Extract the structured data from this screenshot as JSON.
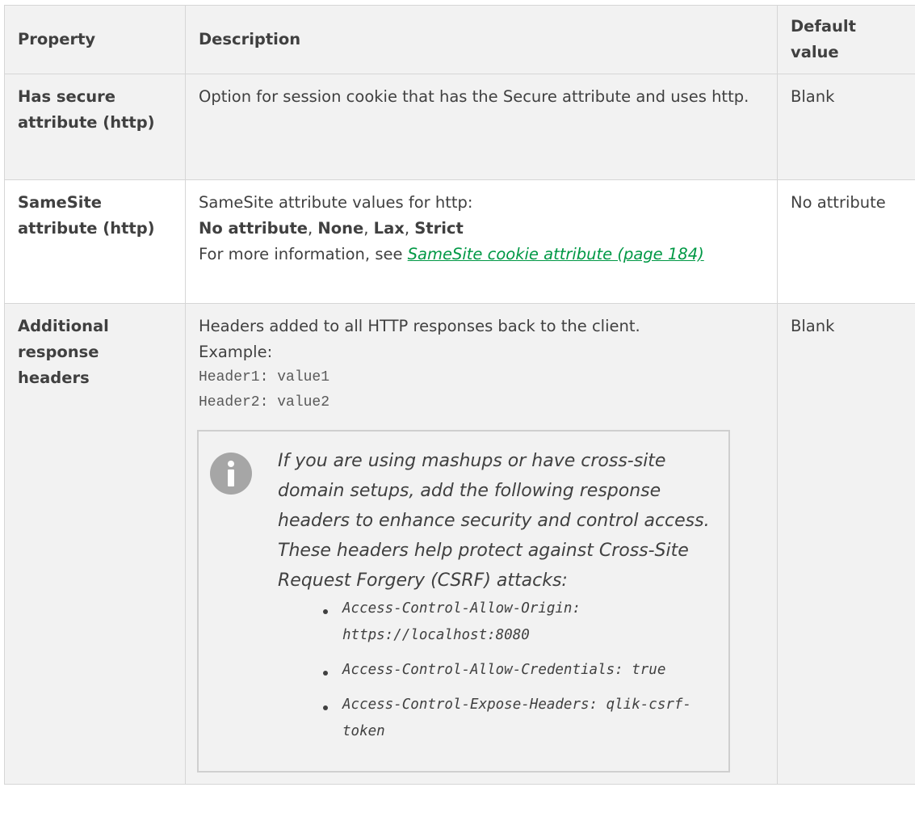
{
  "header": {
    "property": "Property",
    "description": "Description",
    "default_value": "Default value"
  },
  "rows": [
    {
      "property": "Has secure attribute (http)",
      "description": "Option for session cookie that has the Secure attribute and uses http.",
      "default": "Blank"
    },
    {
      "property": "SameSite attribute (http)",
      "description_line1": "SameSite attribute values for http:",
      "options": [
        "No attribute",
        "None",
        "Lax",
        "Strict"
      ],
      "option_separator": ", ",
      "more_info_prefix": "For more information, see ",
      "more_info_link": "SameSite cookie attribute (page 184)",
      "default": "No attribute"
    },
    {
      "property": "Additional response headers",
      "description_line1": "Headers added to all HTTP responses back to the client.",
      "example_label": "Example:",
      "example_code": [
        "Header1: value1",
        "Header2: value2"
      ],
      "note": {
        "icon": "info-icon",
        "text": "If you are using mashups or have cross-site domain setups, add the following response headers to enhance security and control access. These headers help protect against Cross-Site Request Forgery (CSRF) attacks:",
        "items": [
          "Access-Control-Allow-Origin: https://localhost:8080",
          "Access-Control-Allow-Credentials: true",
          "Access-Control-Expose-Headers: qlik-csrf-token"
        ]
      },
      "default": "Blank"
    }
  ],
  "colors": {
    "link": "#009845",
    "shaded_row": "#f2f2f2",
    "border": "#d6d6d6",
    "text": "#404040"
  }
}
